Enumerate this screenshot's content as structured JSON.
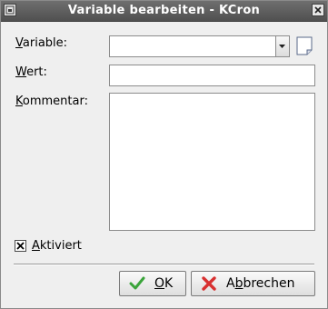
{
  "window": {
    "title": "Variable bearbeiten - KCron"
  },
  "form": {
    "variable": {
      "label_mnemonic": "V",
      "label_rest": "ariable:",
      "value": ""
    },
    "wert": {
      "label_mnemonic": "W",
      "label_rest": "ert:",
      "value": ""
    },
    "kommentar": {
      "label_mnemonic": "K",
      "label_rest": "ommentar:",
      "value": ""
    },
    "aktiviert": {
      "label_mnemonic": "A",
      "label_rest": "ktiviert",
      "checked": true
    }
  },
  "buttons": {
    "ok": {
      "mnemonic": "O",
      "rest": "K"
    },
    "cancel": {
      "pre": "A",
      "mnemonic": "b",
      "rest": "brechen"
    }
  },
  "icons": {
    "ok": "checkmark-icon",
    "cancel": "cross-icon",
    "note": "note-icon"
  },
  "colors": {
    "titlebar": "#5a5a5a",
    "ok_check": "#3aa43a",
    "cancel_x": "#d83030"
  }
}
